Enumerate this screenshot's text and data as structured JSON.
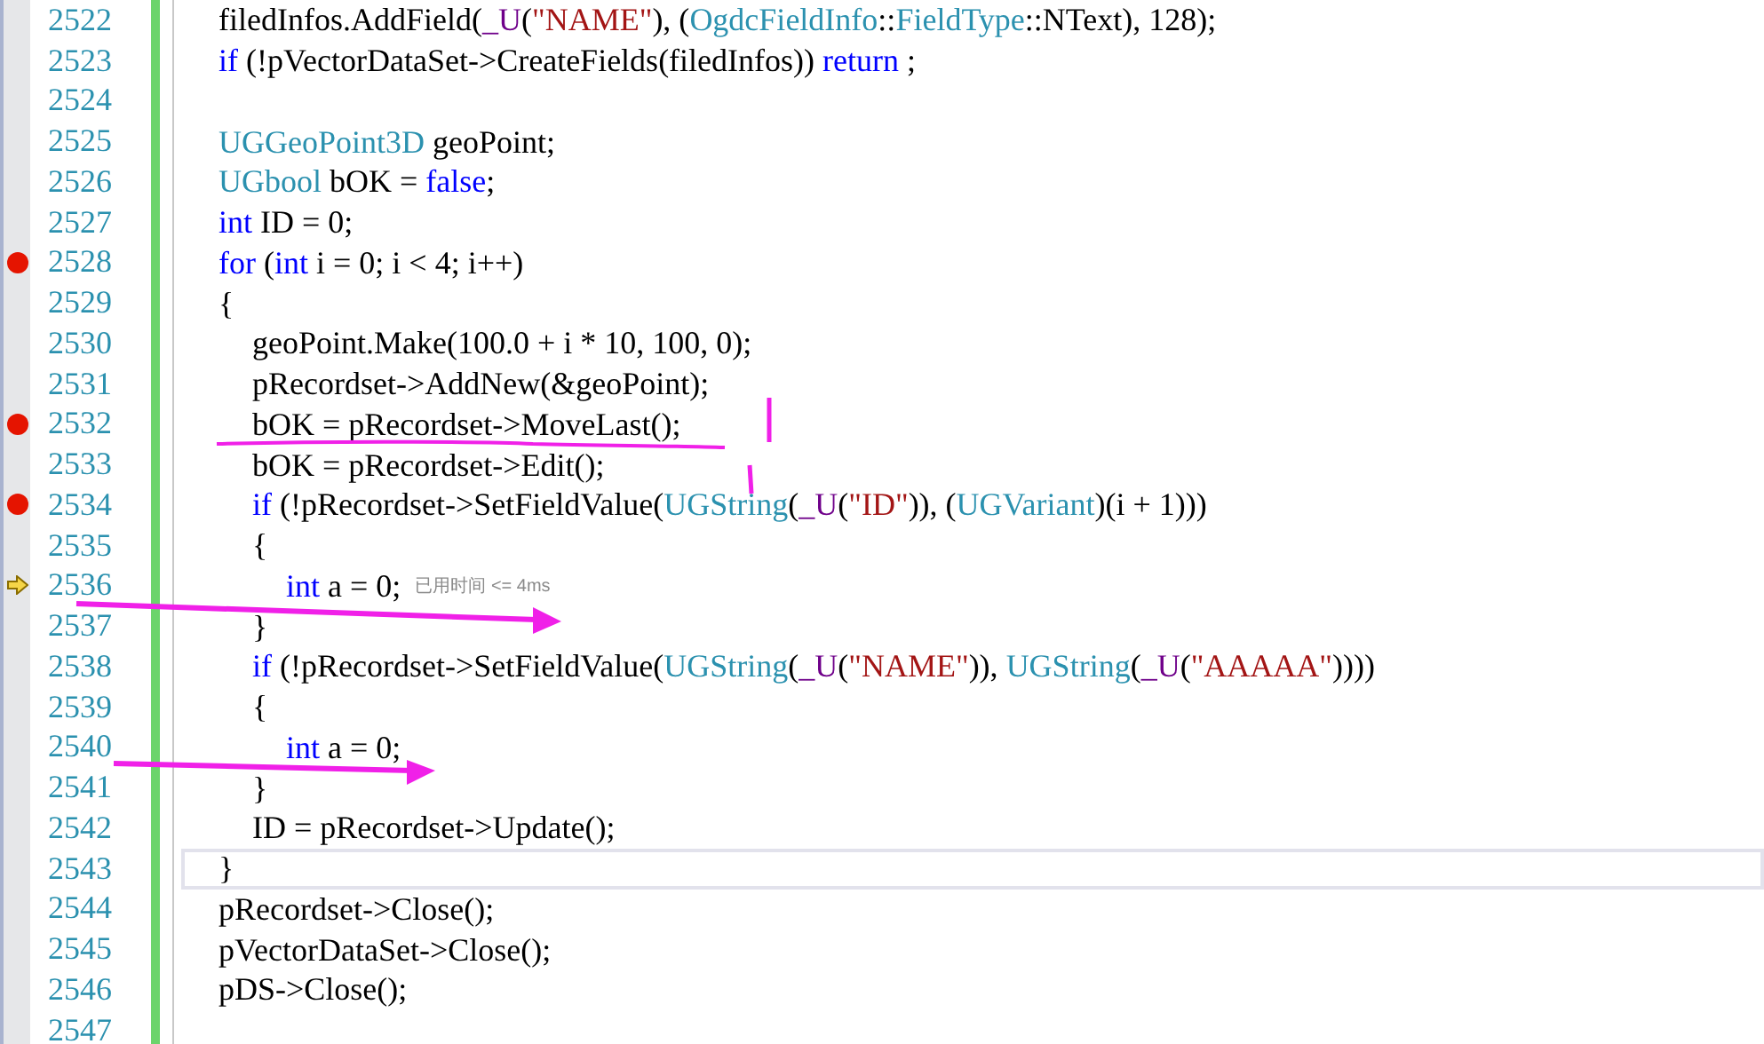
{
  "editor": {
    "lines": [
      {
        "number": "2522",
        "breakpoint": false,
        "current": false,
        "selected": false,
        "tokens": [
          {
            "text": "\tfiledInfos.AddField(",
            "kind": "plain"
          },
          {
            "text": "_U",
            "kind": "macro"
          },
          {
            "text": "(",
            "kind": "plain"
          },
          {
            "text": "\"NAME\"",
            "kind": "string"
          },
          {
            "text": "), (",
            "kind": "plain"
          },
          {
            "text": "OgdcFieldInfo",
            "kind": "type"
          },
          {
            "text": "::",
            "kind": "plain"
          },
          {
            "text": "FieldType",
            "kind": "type"
          },
          {
            "text": "::NText), 128);",
            "kind": "plain"
          }
        ]
      },
      {
        "number": "2523",
        "breakpoint": false,
        "current": false,
        "selected": false,
        "tokens": [
          {
            "text": "\tif",
            "kind": "keyword"
          },
          {
            "text": " (!pVectorDataSet->CreateFields(filedInfos)) ",
            "kind": "plain"
          },
          {
            "text": "return",
            "kind": "keyword"
          },
          {
            "text": " ;",
            "kind": "plain"
          }
        ]
      },
      {
        "number": "2524",
        "breakpoint": false,
        "current": false,
        "selected": false
      },
      {
        "number": "2525",
        "breakpoint": false,
        "current": false,
        "selected": false,
        "tokens": [
          {
            "text": "\tUGGeoPoint3D",
            "kind": "type"
          },
          {
            "text": " geoPoint;",
            "kind": "plain"
          }
        ]
      },
      {
        "number": "2526",
        "breakpoint": false,
        "current": false,
        "selected": false,
        "tokens": [
          {
            "text": "\tUGbool",
            "kind": "type"
          },
          {
            "text": " bOK = ",
            "kind": "plain"
          },
          {
            "text": "false",
            "kind": "keyword"
          },
          {
            "text": ";",
            "kind": "plain"
          }
        ]
      },
      {
        "number": "2527",
        "breakpoint": false,
        "current": false,
        "selected": false,
        "tokens": [
          {
            "text": "\tint",
            "kind": "keyword"
          },
          {
            "text": " ID = 0;",
            "kind": "plain"
          }
        ]
      },
      {
        "number": "2528",
        "breakpoint": true,
        "current": false,
        "selected": false,
        "tokens": [
          {
            "text": "\tfor",
            "kind": "keyword"
          },
          {
            "text": " (",
            "kind": "plain"
          },
          {
            "text": "int",
            "kind": "keyword"
          },
          {
            "text": " i = 0; i < 4; i++)",
            "kind": "plain"
          }
        ]
      },
      {
        "number": "2529",
        "breakpoint": false,
        "current": false,
        "selected": false,
        "tokens": [
          {
            "text": "\t{",
            "kind": "plain"
          }
        ]
      },
      {
        "number": "2530",
        "breakpoint": false,
        "current": false,
        "selected": false,
        "tokens": [
          {
            "text": "\t\tgeoPoint.Make(100.0 + i * 10, 100, 0);",
            "kind": "plain"
          }
        ]
      },
      {
        "number": "2531",
        "breakpoint": false,
        "current": false,
        "selected": false,
        "tokens": [
          {
            "text": "\t\tpRecordset->AddNew(&geoPoint);",
            "kind": "plain"
          }
        ]
      },
      {
        "number": "2532",
        "breakpoint": true,
        "current": false,
        "selected": false,
        "tokens": [
          {
            "text": "\t\tbOK = pRecordset->MoveLast();",
            "kind": "plain"
          }
        ]
      },
      {
        "number": "2533",
        "breakpoint": false,
        "current": false,
        "selected": false,
        "tokens": [
          {
            "text": "\t\tbOK = pRecordset->Edit();",
            "kind": "plain"
          }
        ]
      },
      {
        "number": "2534",
        "breakpoint": true,
        "current": false,
        "selected": false,
        "tokens": [
          {
            "text": "\t\tif",
            "kind": "keyword"
          },
          {
            "text": " (!pRecordset->SetFieldValue(",
            "kind": "plain"
          },
          {
            "text": "UGString",
            "kind": "type"
          },
          {
            "text": "(",
            "kind": "plain"
          },
          {
            "text": "_U",
            "kind": "macro"
          },
          {
            "text": "(",
            "kind": "plain"
          },
          {
            "text": "\"ID\"",
            "kind": "string"
          },
          {
            "text": ")), (",
            "kind": "plain"
          },
          {
            "text": "UGVariant",
            "kind": "type"
          },
          {
            "text": ")(i + 1)))",
            "kind": "plain"
          }
        ]
      },
      {
        "number": "2535",
        "breakpoint": false,
        "current": false,
        "selected": false,
        "tokens": [
          {
            "text": "\t\t{",
            "kind": "plain"
          }
        ]
      },
      {
        "number": "2536",
        "breakpoint": false,
        "current": true,
        "selected": false,
        "hint": "已用时间 <= 4ms",
        "tokens": [
          {
            "text": "\t\t\tint",
            "kind": "keyword"
          },
          {
            "text": " a = 0;",
            "kind": "plain"
          }
        ]
      },
      {
        "number": "2537",
        "breakpoint": false,
        "current": false,
        "selected": false,
        "tokens": [
          {
            "text": "\t\t}",
            "kind": "plain"
          }
        ]
      },
      {
        "number": "2538",
        "breakpoint": false,
        "current": false,
        "selected": false,
        "tokens": [
          {
            "text": "\t\tif",
            "kind": "keyword"
          },
          {
            "text": " (!pRecordset->SetFieldValue(",
            "kind": "plain"
          },
          {
            "text": "UGString",
            "kind": "type"
          },
          {
            "text": "(",
            "kind": "plain"
          },
          {
            "text": "_U",
            "kind": "macro"
          },
          {
            "text": "(",
            "kind": "plain"
          },
          {
            "text": "\"NAME\"",
            "kind": "string"
          },
          {
            "text": ")), ",
            "kind": "plain"
          },
          {
            "text": "UGString",
            "kind": "type"
          },
          {
            "text": "(",
            "kind": "plain"
          },
          {
            "text": "_U",
            "kind": "macro"
          },
          {
            "text": "(",
            "kind": "plain"
          },
          {
            "text": "\"AAAAA\"",
            "kind": "string"
          },
          {
            "text": "))))",
            "kind": "plain"
          }
        ]
      },
      {
        "number": "2539",
        "breakpoint": false,
        "current": false,
        "selected": false,
        "tokens": [
          {
            "text": "\t\t{",
            "kind": "plain"
          }
        ]
      },
      {
        "number": "2540",
        "breakpoint": false,
        "current": false,
        "selected": false,
        "tokens": [
          {
            "text": "\t\t\tint",
            "kind": "keyword"
          },
          {
            "text": " a = 0;",
            "kind": "plain"
          }
        ]
      },
      {
        "number": "2541",
        "breakpoint": false,
        "current": false,
        "selected": false,
        "tokens": [
          {
            "text": "\t\t}",
            "kind": "plain"
          }
        ]
      },
      {
        "number": "2542",
        "breakpoint": false,
        "current": false,
        "selected": false,
        "tokens": [
          {
            "text": "\t\tID = pRecordset->Update();",
            "kind": "plain"
          }
        ]
      },
      {
        "number": "2543",
        "breakpoint": false,
        "current": false,
        "selected": true,
        "tokens": [
          {
            "text": "\t}",
            "kind": "plain"
          }
        ]
      },
      {
        "number": "2544",
        "breakpoint": false,
        "current": false,
        "selected": false,
        "tokens": [
          {
            "text": "\tpRecordset->Close();",
            "kind": "plain"
          }
        ]
      },
      {
        "number": "2545",
        "breakpoint": false,
        "current": false,
        "selected": false,
        "tokens": [
          {
            "text": "\tpVectorDataSet->Close();",
            "kind": "plain"
          }
        ]
      },
      {
        "number": "2546",
        "breakpoint": false,
        "current": false,
        "selected": false,
        "tokens": [
          {
            "text": "\tpDS->Close();",
            "kind": "plain"
          }
        ]
      },
      {
        "number": "2547",
        "breakpoint": false,
        "current": false,
        "selected": false
      }
    ]
  }
}
